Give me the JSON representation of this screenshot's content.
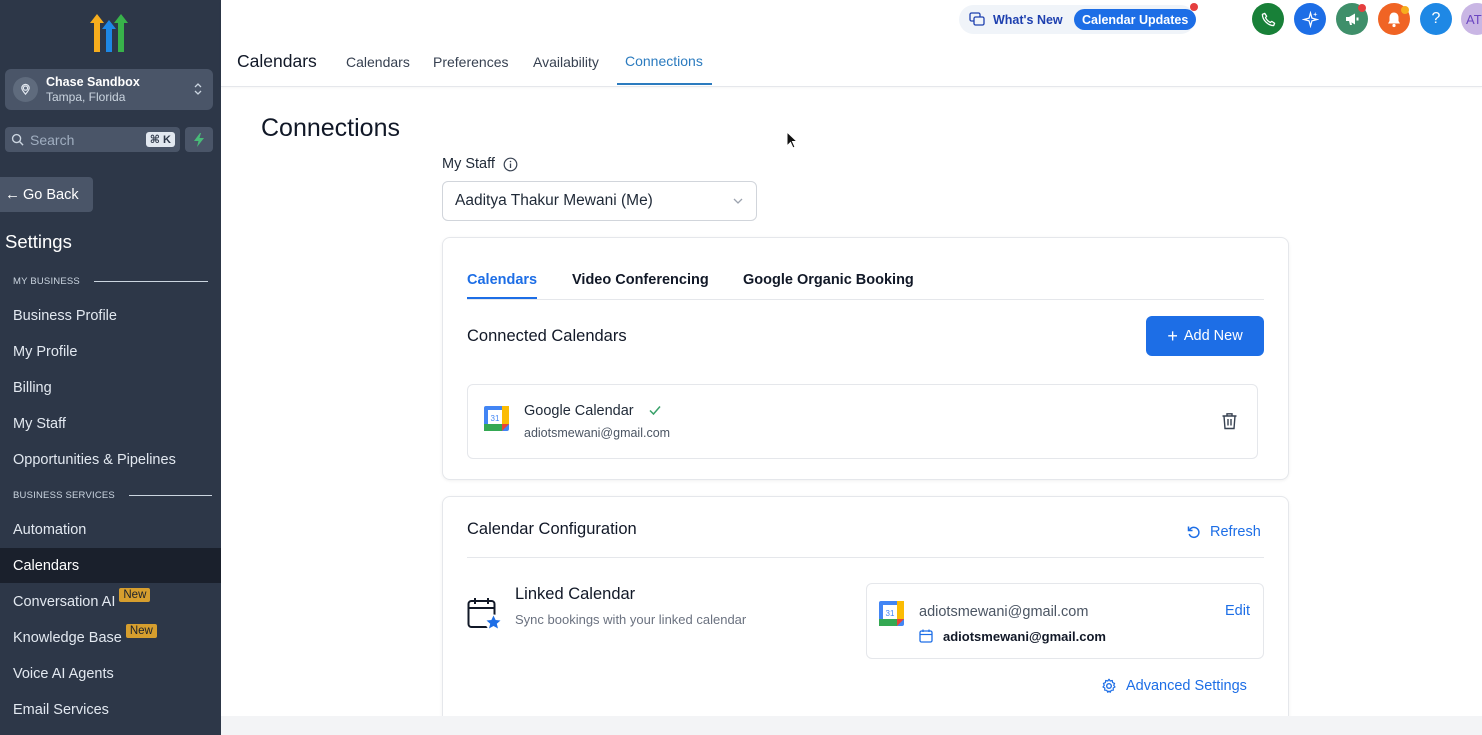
{
  "sidebar": {
    "account": {
      "name": "Chase Sandbox",
      "location": "Tampa, Florida"
    },
    "search": {
      "label": "Search",
      "shortcut": "⌘ K"
    },
    "go_back": "Go Back",
    "settings_title": "Settings",
    "section_my_business": "MY BUSINESS",
    "section_business_services": "BUSINESS SERVICES",
    "items": [
      {
        "label": "Business Profile"
      },
      {
        "label": "My Profile"
      },
      {
        "label": "Billing"
      },
      {
        "label": "My Staff"
      },
      {
        "label": "Opportunities & Pipelines"
      },
      {
        "label": "Automation"
      },
      {
        "label": "Calendars"
      },
      {
        "label": "Conversation AI",
        "badge": "New"
      },
      {
        "label": "Knowledge Base",
        "badge": "New"
      },
      {
        "label": "Voice AI Agents"
      },
      {
        "label": "Email Services"
      }
    ],
    "active_item": "Calendars"
  },
  "header": {
    "title": "Calendars",
    "tabs": [
      {
        "label": "Calendars"
      },
      {
        "label": "Preferences"
      },
      {
        "label": "Availability"
      },
      {
        "label": "Connections"
      }
    ],
    "active_tab": "Connections",
    "whats_new": "What's New",
    "calendar_updates": "Calendar Updates",
    "avatar_initials": "AT"
  },
  "main": {
    "title": "Connections",
    "staff_label": "My Staff",
    "staff_selected": "Aaditya Thakur Mewani (Me)",
    "inner_tabs": [
      {
        "label": "Calendars"
      },
      {
        "label": "Video Conferencing"
      },
      {
        "label": "Google Organic Booking"
      }
    ],
    "connected_heading": "Connected Calendars",
    "add_new": "Add New",
    "connected": {
      "name": "Google Calendar",
      "email": "adiotsmewani@gmail.com",
      "icon_day": "31"
    },
    "config_heading": "Calendar Configuration",
    "refresh": "Refresh",
    "linked_title": "Linked Calendar",
    "linked_subtitle": "Sync bookings with your linked calendar",
    "linked_account": "adiotsmewani@gmail.com",
    "linked_calendar": "adiotsmewani@gmail.com",
    "edit": "Edit",
    "advanced_settings": "Advanced Settings"
  },
  "colors": {
    "sidebar_bg": "#2d3748",
    "primary": "#1d6ee6",
    "tab_active": "#2b7bbf",
    "badge_new": "#d69e2e"
  }
}
